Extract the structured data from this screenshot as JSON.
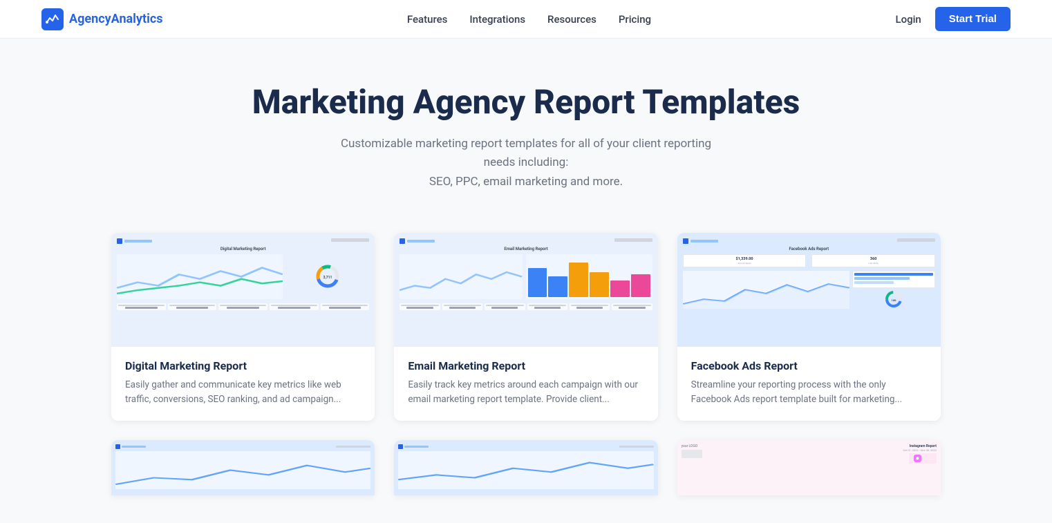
{
  "nav": {
    "logo_text_regular": "Agency",
    "logo_text_bold": "Analytics",
    "links": [
      {
        "label": "Features",
        "href": "#"
      },
      {
        "label": "Integrations",
        "href": "#"
      },
      {
        "label": "Resources",
        "href": "#"
      },
      {
        "label": "Pricing",
        "href": "#"
      }
    ],
    "login_label": "Login",
    "start_trial_label": "Start Trial"
  },
  "hero": {
    "title": "Marketing Agency Report Templates",
    "subtitle_line1": "Customizable marketing report templates for all of your client reporting needs including:",
    "subtitle_line2": "SEO, PPC, email marketing and more."
  },
  "cards": [
    {
      "id": "digital-marketing",
      "title": "Digital Marketing Report",
      "description": "Easily gather and communicate key metrics like web traffic, conversions, SEO ranking, and ad campaign..."
    },
    {
      "id": "email-marketing",
      "title": "Email Marketing Report",
      "description": "Easily track key metrics around each campaign with our email marketing report template. Provide client..."
    },
    {
      "id": "facebook-ads",
      "title": "Facebook Ads Report",
      "description": "Streamline your reporting process with the only Facebook Ads report template built for marketing..."
    }
  ],
  "bottom_cards": [
    {
      "id": "card-4",
      "type": "agency-analytics"
    },
    {
      "id": "card-5",
      "type": "agency-analytics"
    },
    {
      "id": "card-6",
      "type": "instagram"
    }
  ],
  "colors": {
    "brand_blue": "#2563eb",
    "dark_navy": "#1a2b4b",
    "light_bg": "#f8f9fb"
  }
}
